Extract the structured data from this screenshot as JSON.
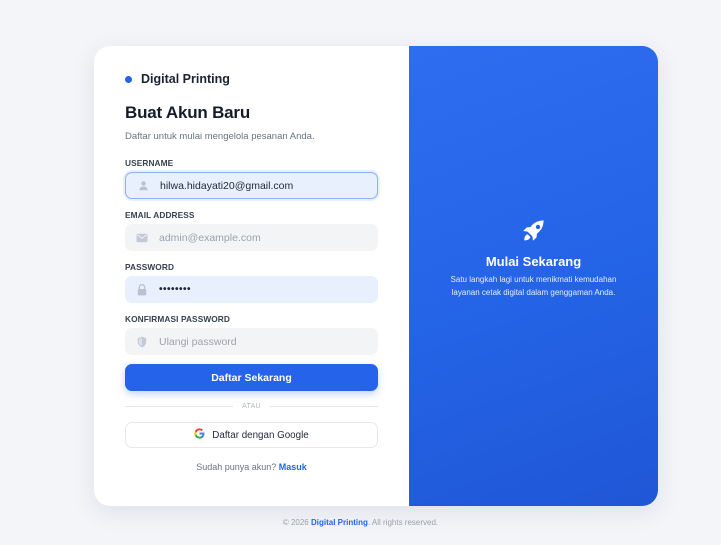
{
  "brand": {
    "name": "Digital Printing"
  },
  "form": {
    "title": "Buat Akun Baru",
    "subtitle": "Daftar untuk mulai mengelola pesanan Anda.",
    "username": {
      "label": "USERNAME",
      "value": "hilwa.hidayati20@gmail.com",
      "icon": "user-icon"
    },
    "email": {
      "label": "EMAIL ADDRESS",
      "placeholder": "admin@example.com",
      "icon": "mail-icon"
    },
    "password": {
      "label": "PASSWORD",
      "value_masked": "••••••••",
      "icon": "lock-icon"
    },
    "confirm_password": {
      "label": "KONFIRMASI PASSWORD",
      "placeholder": "Ulangi password",
      "icon": "shield-icon"
    },
    "submit_label": "Daftar Sekarang",
    "divider_text": "ATAU",
    "google_label": "Daftar dengan Google",
    "login_prompt": "Sudah punya akun?",
    "login_link": "Masuk"
  },
  "promo": {
    "icon": "rocket-icon",
    "title": "Mulai Sekarang",
    "description": "Satu langkah lagi untuk menikmati kemudahan layanan cetak digital dalam genggaman Anda."
  },
  "footer": {
    "prefix": "© 2026",
    "brand": "Digital Printing",
    "suffix": ". All rights reserved."
  },
  "colors": {
    "accent": "#2563eb",
    "panel": "#2463e6",
    "background": "#f4f5f8"
  }
}
